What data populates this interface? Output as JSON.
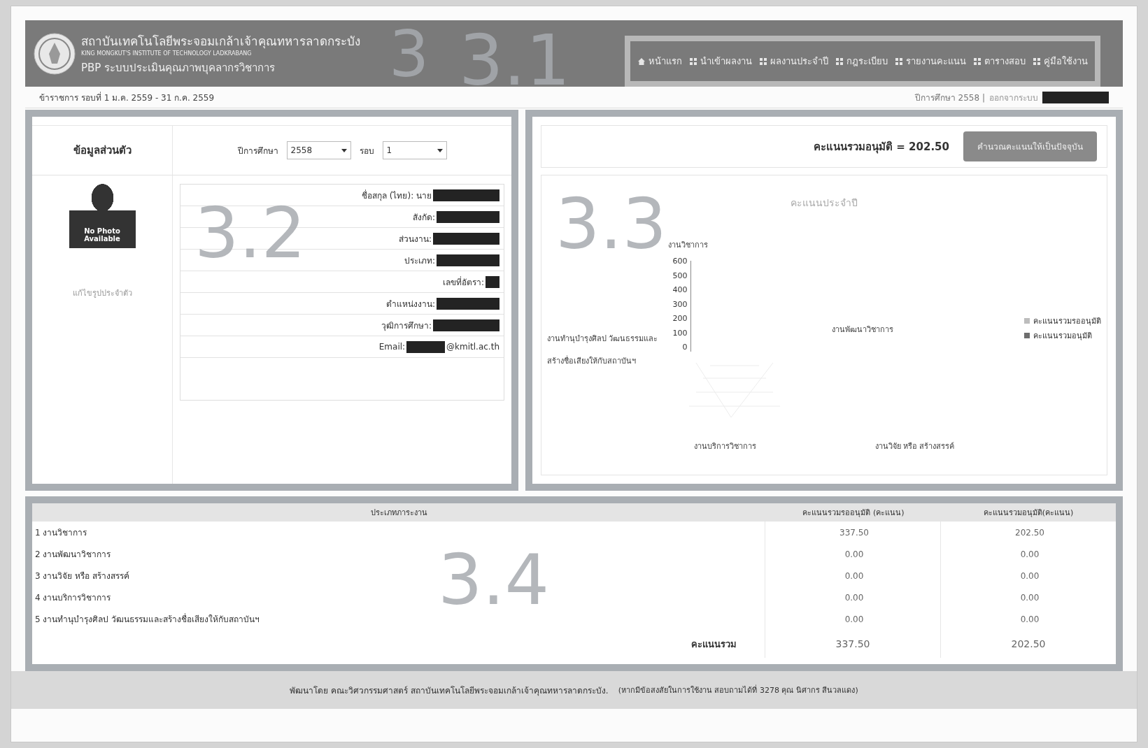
{
  "header": {
    "institute_th": "สถาบันเทคโนโลยีพระจอมเกล้าเจ้าคุณทหารลาดกระบัง",
    "institute_en": "KING MONGKUT'S INSTITUTE OF TECHNOLOGY LADKRABANG",
    "system": "PBP ระบบประเมินคุณภาพบุคลากรวิชาการ"
  },
  "nav": [
    {
      "label": "หน้าแรก",
      "kind": "home"
    },
    {
      "label": "นำเข้าผลงาน",
      "kind": "grid"
    },
    {
      "label": "ผลงานประจำปี",
      "kind": "grid"
    },
    {
      "label": "กฎระเบียบ",
      "kind": "grid"
    },
    {
      "label": "รายงานคะแนน",
      "kind": "grid"
    },
    {
      "label": "ตารางสอบ",
      "kind": "grid"
    },
    {
      "label": "คู่มือใช้งาน",
      "kind": "grid"
    }
  ],
  "subbar": {
    "period": "ข้าราชการ รอบที่ 1 ม.ค. 2559 - 31 ก.ค. 2559",
    "year": "ปีการศึกษา 2558 |",
    "logout": "ออกจากระบบ"
  },
  "profile": {
    "title": "ข้อมูลส่วนตัว",
    "year_label": "ปีการศึกษา",
    "year_value": "2558",
    "round_label": "รอบ",
    "round_value": "1",
    "photo_text": "No Photo Available",
    "edit_photo": "แก้ไขรูปประจำตัว",
    "fields": [
      {
        "label": "ชื่อสกุล (ไทย): นาย"
      },
      {
        "label": "สังกัด:"
      },
      {
        "label": "ส่วนงาน:"
      },
      {
        "label": "ประเภท:"
      },
      {
        "label": "เลขที่อัตรา:"
      },
      {
        "label": "ตำแหน่งงาน:"
      },
      {
        "label": "วุฒิการศึกษา:"
      },
      {
        "label": "Email:",
        "suffix": "@kmitl.ac.th"
      }
    ]
  },
  "score": {
    "summary": "คะแนนรวมอนุมัติ = 202.50",
    "button": "คำนวณคะแนนให้เป็นปัจจุบัน"
  },
  "chart": {
    "title": "คะแนนประจำปี",
    "axis_top": "งานวิชาการ",
    "axis_right": "งานพัฒนาวิชาการ",
    "axis_bottom_right": "งานวิจัย หรือ สร้างสรรค์",
    "axis_bottom_left": "งานบริการวิชาการ",
    "axis_left": [
      "งานทำนุบำรุงศิลป วัฒนธรรมและ",
      "สร้างชื่อเสียงให้กับสถาบันฯ"
    ],
    "ticks": [
      "600",
      "500",
      "400",
      "300",
      "200",
      "100",
      "0"
    ],
    "legend": [
      {
        "label": "คะแนนรวมรออนุมัติ",
        "color": "#bdbdbd"
      },
      {
        "label": "คะแนนรวมอนุมัติ",
        "color": "#6e6e6e"
      }
    ]
  },
  "table": {
    "columns": [
      "ประเภทภาระงาน",
      "คะแนนรวมรออนุมัติ (คะแนน)",
      "คะแนนรวมอนุมัติ(คะแนน)"
    ],
    "rows": [
      {
        "label": "1 งานวิชาการ",
        "pending": "337.50",
        "approved": "202.50"
      },
      {
        "label": "2 งานพัฒนาวิชาการ",
        "pending": "0.00",
        "approved": "0.00"
      },
      {
        "label": "3 งานวิจัย หรือ สร้างสรรค์",
        "pending": "0.00",
        "approved": "0.00"
      },
      {
        "label": "4 งานบริการวิชาการ",
        "pending": "0.00",
        "approved": "0.00"
      },
      {
        "label": "5 งานทำนุบำรุงศิลป วัฒนธรรมและสร้างชื่อเสียงให้กับสถาบันฯ",
        "pending": "0.00",
        "approved": "0.00"
      }
    ],
    "total": {
      "label": "คะแนนรวม",
      "pending": "337.50",
      "approved": "202.50"
    }
  },
  "footer": {
    "credit": "พัฒนาโดย คณะวิศวกรรมศาสตร์ สถาบันเทคโนโลยีพระจอมเกล้าเจ้าคุณทหารลาดกระบัง.",
    "contact": "(หากมีข้อสงสัยในการใช้งาน สอบถามได้ที่ 3278 คุณ นิศากร สีนวลแดง)"
  },
  "annotations": [
    "3",
    "3.1",
    "3.2",
    "3.3",
    "3.4"
  ]
}
